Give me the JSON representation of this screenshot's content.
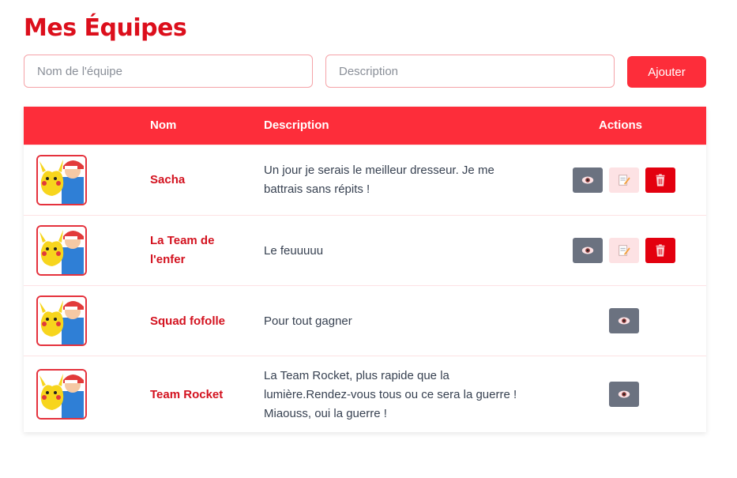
{
  "page": {
    "title": "Mes Équipes"
  },
  "form": {
    "name_placeholder": "Nom de l'équipe",
    "description_placeholder": "Description",
    "add_label": "Ajouter"
  },
  "table": {
    "headers": {
      "image": "",
      "nom": "Nom",
      "description": "Description",
      "actions": "Actions"
    },
    "rows": [
      {
        "nom": "Sacha",
        "description": "Un jour je serais le meilleur dresseur. Je me battrais sans répits !",
        "actions": [
          "view-eye-icon",
          "edit-memo-icon",
          "delete-trash-icon"
        ]
      },
      {
        "nom": "La Team de l'enfer",
        "description": "Le feuuuuu",
        "actions": [
          "view-eye-icon",
          "edit-memo-icon",
          "delete-trash-icon"
        ]
      },
      {
        "nom": "Squad fofolle",
        "description": "Pour tout gagner",
        "actions": [
          "view-eye-icon"
        ]
      },
      {
        "nom": "Team Rocket",
        "description": "La Team Rocket, plus rapide que la lumière.Rendez-vous tous ou ce sera la guerre ! Miaouss, oui la guerre !",
        "actions": [
          "view-eye-icon"
        ]
      }
    ]
  },
  "colors": {
    "accent": "#fd2d3a",
    "title": "#dc0f1c",
    "name_text": "#d3121f",
    "view_button": "#6b7280",
    "edit_button": "#fde2e4",
    "delete_button": "#e3000f"
  }
}
